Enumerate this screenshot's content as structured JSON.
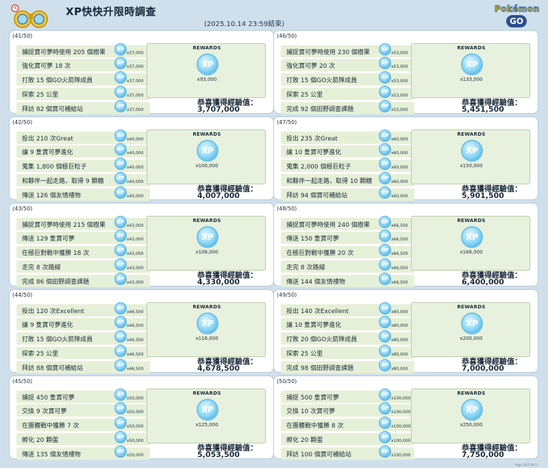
{
  "header": {
    "title": "XP快快升限時調查",
    "deadline": "(2025.10.14 23:59結束)",
    "brand_top": "Pokémon",
    "brand_bottom": "GO"
  },
  "labels": {
    "rewards": "REWARDS",
    "xp": "XP",
    "total_label": "恭喜獲得經驗值："
  },
  "colors": {
    "page_bg": "#cfe0ec",
    "task_bg": "#e6f0d8",
    "xp_blue": "#7dcdf2"
  },
  "footnote": "Page 2025.09.11",
  "levels": [
    {
      "level": "(41/50)",
      "tasks": [
        {
          "label": "捕捉寶可夢時使用 205 個樹果",
          "xp": "x37,000"
        },
        {
          "label": "強化寶可夢 18 次",
          "xp": "x37,000"
        },
        {
          "label": "打敗 15 個GO火箭隊成員",
          "xp": "x37,000"
        },
        {
          "label": "探索 25 公里",
          "xp": "x37,000"
        },
        {
          "label": "拜訪 82 個寶可補給站",
          "xp": "x37,000"
        }
      ],
      "reward": "x93,000",
      "total": "3,707,000"
    },
    {
      "level": "(46/50)",
      "tasks": [
        {
          "label": "捕捉寶可夢時使用 230 個樹果",
          "xp": "x53,000"
        },
        {
          "label": "強化寶可夢 20 次",
          "xp": "x53,000"
        },
        {
          "label": "打敗 15 個GO火箭隊成員",
          "xp": "x53,000"
        },
        {
          "label": "探索 25 公里",
          "xp": "x53,000"
        },
        {
          "label": "完成 92 個田野調查課題",
          "xp": "x53,000"
        }
      ],
      "reward": "x133,000",
      "total": "5,451,500"
    },
    {
      "level": "(42/50)",
      "tasks": [
        {
          "label": "投出 210 次Great",
          "xp": "x40,000"
        },
        {
          "label": "讓 9 隻寶可夢進化",
          "xp": "x40,000"
        },
        {
          "label": "蒐集 1,800 個極巨粒子",
          "xp": "x40,000"
        },
        {
          "label": "和夥伴一起走路，取得 9 顆糖",
          "xp": "x40,000"
        },
        {
          "label": "傳送 126 個友情禮物",
          "xp": "x40,000"
        }
      ],
      "reward": "x100,000",
      "total": "4,007,000"
    },
    {
      "level": "(47/50)",
      "tasks": [
        {
          "label": "投出 235 次Great",
          "xp": "x60,000"
        },
        {
          "label": "讓 10 隻寶可夢進化",
          "xp": "x60,000"
        },
        {
          "label": "蒐集 2,000 個極巨粒子",
          "xp": "x60,000"
        },
        {
          "label": "和夥伴一起走路，取得 10 顆糖",
          "xp": "x60,000"
        },
        {
          "label": "拜訪 94 個寶可補給站",
          "xp": "x60,000"
        }
      ],
      "reward": "x150,000",
      "total": "5,901,500"
    },
    {
      "level": "(43/50)",
      "tasks": [
        {
          "label": "捕捉寶可夢時使用 215 個樹果",
          "xp": "x43,000"
        },
        {
          "label": "傳送 129 隻寶可夢",
          "xp": "x43,000"
        },
        {
          "label": "在極巨對戰中獲勝 18 次",
          "xp": "x43,000"
        },
        {
          "label": "走完 8 次路線",
          "xp": "x43,000"
        },
        {
          "label": "完成 86 個田野調查課題",
          "xp": "x43,000"
        }
      ],
      "reward": "x108,000",
      "total": "4,330,000"
    },
    {
      "level": "(48/50)",
      "tasks": [
        {
          "label": "捕捉寶可夢時使用 240 個樹果",
          "xp": "x66,500"
        },
        {
          "label": "傳送 150 隻寶可夢",
          "xp": "x66,500"
        },
        {
          "label": "在極巨對戰中獲勝 20 次",
          "xp": "x66,500"
        },
        {
          "label": "走完 8 次路線",
          "xp": "x66,500"
        },
        {
          "label": "傳送 144 個友情禮物",
          "xp": "x66,500"
        }
      ],
      "reward": "x166,000",
      "total": "6,400,000"
    },
    {
      "level": "(44/50)",
      "tasks": [
        {
          "label": "投出 120 次Excellent",
          "xp": "x46,500"
        },
        {
          "label": "讓 9 隻寶可夢進化",
          "xp": "x46,500"
        },
        {
          "label": "打敗 15 個GO火箭隊成員",
          "xp": "x46,500"
        },
        {
          "label": "探索 25 公里",
          "xp": "x46,500"
        },
        {
          "label": "拜訪 88 個寶可補給站",
          "xp": "x46,500"
        }
      ],
      "reward": "x116,000",
      "total": "4,678,500"
    },
    {
      "level": "(49/50)",
      "tasks": [
        {
          "label": "投出 140 次Excellent",
          "xp": "x80,000"
        },
        {
          "label": "讓 10 隻寶可夢進化",
          "xp": "x80,000"
        },
        {
          "label": "打敗 20 個GO火箭隊成員",
          "xp": "x80,000"
        },
        {
          "label": "探索 25 公里",
          "xp": "x80,000"
        },
        {
          "label": "完成 98 個田野調查課題",
          "xp": "x80,000"
        }
      ],
      "reward": "x200,000",
      "total": "7,000,000"
    },
    {
      "level": "(45/50)",
      "tasks": [
        {
          "label": "捕捉 450 隻寶可夢",
          "xp": "x50,000"
        },
        {
          "label": "交換 9 次寶可夢",
          "xp": "x50,000"
        },
        {
          "label": "在團體戰中獲勝 7 次",
          "xp": "x50,000"
        },
        {
          "label": "孵化 20 顆蛋",
          "xp": "x50,000"
        },
        {
          "label": "傳送 135 個友情禮物",
          "xp": "x50,000"
        }
      ],
      "reward": "x125,000",
      "total": "5,053,500"
    },
    {
      "level": "(50/50)",
      "tasks": [
        {
          "label": "捕捉 500 隻寶可夢",
          "xp": "x100,000"
        },
        {
          "label": "交換 10 次寶可夢",
          "xp": "x100,000"
        },
        {
          "label": "在團體戰中獲勝 8 次",
          "xp": "x100,000"
        },
        {
          "label": "孵化 20 顆蛋",
          "xp": "x100,000"
        },
        {
          "label": "拜訪 100 個寶可補給站",
          "xp": "x100,000"
        }
      ],
      "reward": "x250,000",
      "total": "7,750,000"
    }
  ]
}
